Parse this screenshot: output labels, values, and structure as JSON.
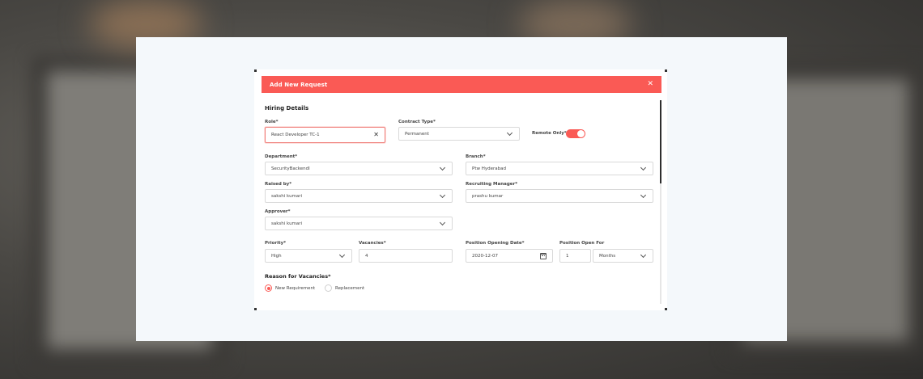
{
  "modal": {
    "title": "Add New Request"
  },
  "hiring_details": {
    "section_title": "Hiring Details",
    "role": {
      "label": "Role*",
      "value": "React Developer TC-1"
    },
    "contract_type": {
      "label": "Contract Type*",
      "value": "Permanent"
    },
    "remote_only": {
      "label": "Remote Only*",
      "enabled": true
    },
    "department": {
      "label": "Department*",
      "value": "SecurityBackendl"
    },
    "branch": {
      "label": "Branch*",
      "value": "Ptw Hyderabad"
    },
    "raised_by": {
      "label": "Raised by*",
      "value": "sakshi kumari"
    },
    "recruiting_manager": {
      "label": "Recruiting Manager*",
      "value": "prashu kumar"
    },
    "approver": {
      "label": "Approver*",
      "value": "sakshi kumari"
    },
    "priority": {
      "label": "Priority*",
      "value": "High"
    },
    "vacancies": {
      "label": "Vacancies*",
      "value": "4"
    },
    "position_opening_date": {
      "label": "Position Opening Date*",
      "value": "2020-12-07"
    },
    "position_open_for": {
      "label": "Position Open For",
      "number": "1",
      "unit": "Months"
    }
  },
  "reason": {
    "section_title": "Reason for Vacancies*",
    "options": [
      {
        "label": "New Requirement",
        "checked": true
      },
      {
        "label": "Replacement",
        "checked": false
      }
    ]
  },
  "colors": {
    "accent": "#fa5a55",
    "backdrop": "#f4f8fb"
  }
}
